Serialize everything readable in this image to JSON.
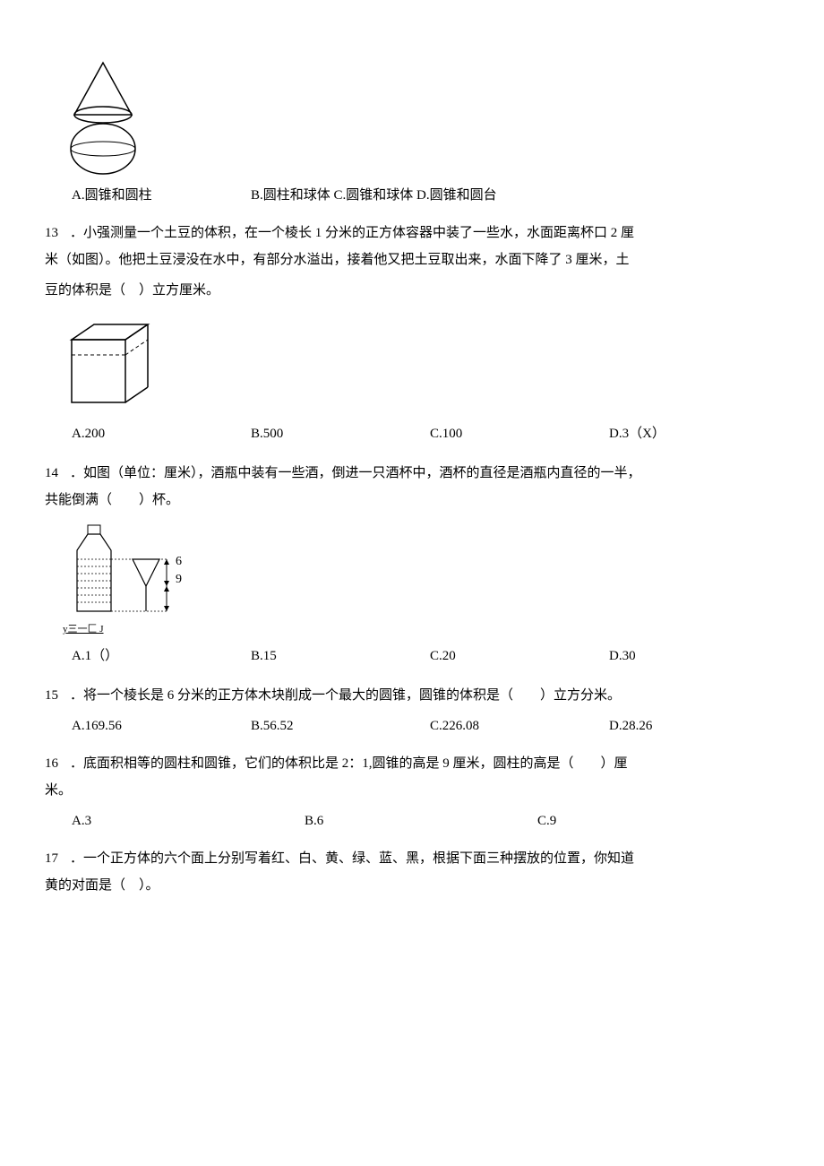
{
  "q12": {
    "options": {
      "a": "A.圆锥和圆柱",
      "b": "B.圆柱和球体 C.圆锥和球体 D.圆锥和圆台"
    }
  },
  "q13": {
    "num": "13",
    "line1": "．小强测量一个土豆的体积，在一个棱长 1 分米的正方体容器中装了一些水，水面距离杯口 2 厘",
    "line2": "米（如图）。他把土豆浸没在水中，有部分水溢出，接着他又把土豆取出来，水面下降了 3 厘米，土",
    "line3": "豆的体积是（　）立方厘米。",
    "options": {
      "a": "A.200",
      "b": "B.500",
      "c": "C.100",
      "d": "D.3（X）"
    }
  },
  "q14": {
    "num": "14",
    "line1": "．如图（单位：厘米），酒瓶中装有一些酒，倒进一只酒杯中，酒杯的直径是酒瓶内直径的一半，",
    "line2": "共能倒满（　　）杯。",
    "fig_label_6": "6",
    "fig_label_9": "9",
    "fig_caption": "y三一匚 J",
    "options": {
      "a": "A.1（）",
      "b": "B.15",
      "c": "C.20",
      "d": "D.30"
    }
  },
  "q15": {
    "num": "15",
    "line1": "．将一个棱长是 6 分米的正方体木块削成一个最大的圆锥，圆锥的体积是（　　）立方分米。",
    "options": {
      "a": "A.169.56",
      "b": "B.56.52",
      "c": "C.226.08",
      "d": "D.28.26"
    }
  },
  "q16": {
    "num": "16",
    "line1": "．底面积相等的圆柱和圆锥，它们的体积比是 2：1,圆锥的高是 9 厘米，圆柱的高是（　　）厘",
    "line2": "米。",
    "options": {
      "a": "A.3",
      "b": "B.6",
      "c": "C.9"
    }
  },
  "q17": {
    "num": "17",
    "line1": "．一个正方体的六个面上分别写着红、白、黄、绿、蓝、黑，根据下面三种摆放的位置，你知道",
    "line2": "黄的对面是（　）。"
  }
}
